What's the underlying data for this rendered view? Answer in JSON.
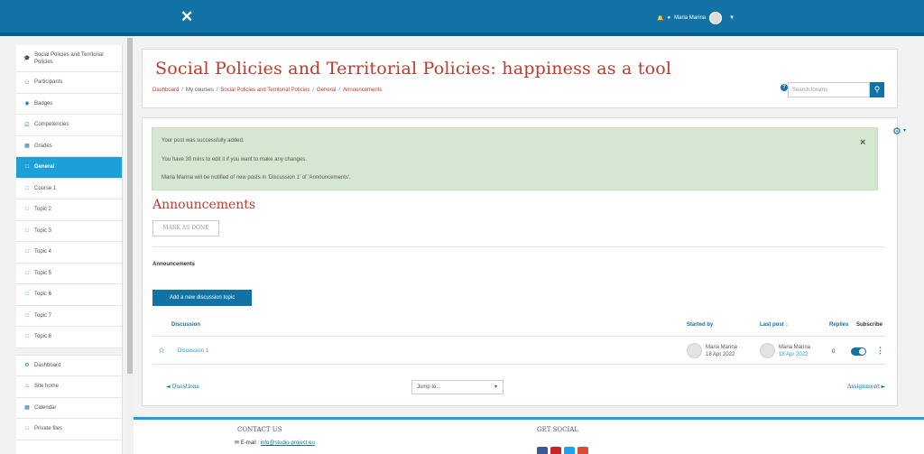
{
  "colors": {
    "brand": "#1172a6",
    "accent": "#1d9fd8",
    "title": "#c0392b",
    "alert_bg": "#d6e7d1"
  },
  "navbar": {
    "close_icon": "close-icon",
    "user_name": "Maria Marina",
    "icons": [
      "bell-icon",
      "chat-icon",
      "avatar",
      "chevron-down-icon"
    ]
  },
  "sidebar": {
    "items": [
      {
        "label": "Social Policies and Territorial Policies",
        "icon": "graduation-cap-icon"
      },
      {
        "label": "Participants",
        "icon": "users-icon"
      },
      {
        "label": "Badges",
        "icon": "badge-icon"
      },
      {
        "label": "Competencies",
        "icon": "checkbox-icon"
      },
      {
        "label": "Grades",
        "icon": "table-icon"
      },
      {
        "label": "General",
        "icon": "folder-icon",
        "active": true
      },
      {
        "label": "Course 1",
        "icon": "folder-icon"
      },
      {
        "label": "Topic 2",
        "icon": "folder-icon"
      },
      {
        "label": "Topic 3",
        "icon": "folder-icon"
      },
      {
        "label": "Topic 4",
        "icon": "folder-icon"
      },
      {
        "label": "Topic 5",
        "icon": "folder-icon"
      },
      {
        "label": "Topic 6",
        "icon": "folder-icon"
      },
      {
        "label": "Topic 7",
        "icon": "folder-icon"
      },
      {
        "label": "Topic 8",
        "icon": "folder-icon"
      },
      {
        "label": "Dashboard",
        "icon": "dashboard-icon"
      },
      {
        "label": "Site home",
        "icon": "home-icon"
      },
      {
        "label": "Calendar",
        "icon": "calendar-icon"
      },
      {
        "label": "Private files",
        "icon": "file-icon"
      }
    ]
  },
  "header": {
    "title": "Social Policies and Territorial Policies: happiness as a tool",
    "breadcrumb": [
      "Dashboard",
      "My courses",
      "Social Policies and Territorial Policies",
      "General",
      "Announcements"
    ],
    "search_placeholder": "Search forums"
  },
  "main": {
    "alert": {
      "line1": "Your post was successfully added.",
      "line2": "You have 30 mins to edit it if you want to make any changes.",
      "line3": "Maria Marina will be notified of new posts in 'Discussion 1' of 'Announcements'.",
      "close": "×"
    },
    "section_title": "Announcements",
    "mark_done": "MARK AS DONE",
    "forum_name": "Announcements",
    "add_button": "Add a new discussion topic",
    "table": {
      "headers": {
        "discussion": "Discussion",
        "started_by": "Started by",
        "last_post": "Last post ↓",
        "replies": "Replies",
        "subscribe": "Subscribe"
      },
      "rows": [
        {
          "discussion": "Discussion 1",
          "started_name": "Maria Marina",
          "started_date": "18 Apr 2022",
          "last_name": "Maria Marina",
          "last_date": "18 Apr 2022",
          "replies": "0",
          "subscribed": true
        }
      ]
    },
    "prev_link": "◄ Questions",
    "jump_to": "Jump to...",
    "next_link": "Assignment ►"
  },
  "footer": {
    "contact_title": "CONTACT US",
    "email_label": "E-mail :",
    "email": "info@studio-project.eu",
    "social_title": "GET SOCIAL",
    "social_colors": [
      "#3b5998",
      "#c8232c",
      "#1da1f2",
      "#dd4b39"
    ]
  }
}
